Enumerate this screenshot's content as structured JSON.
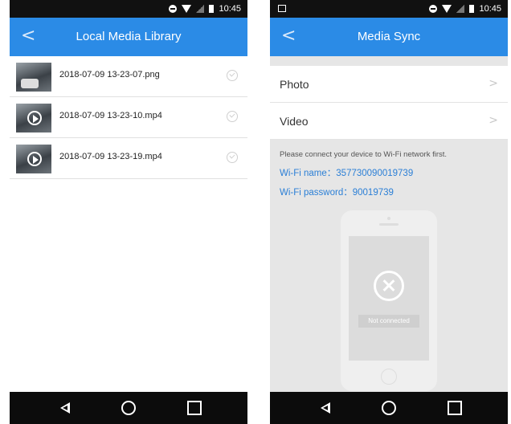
{
  "left_screen": {
    "status": {
      "time": "10:45"
    },
    "appbar": {
      "back_glyph": "<",
      "title": "Local Media Library"
    },
    "files": [
      {
        "name": "2018-07-09 13-23-07.png",
        "type": "image"
      },
      {
        "name": "2018-07-09 13-23-10.mp4",
        "type": "video"
      },
      {
        "name": "2018-07-09 13-23-19.mp4",
        "type": "video"
      }
    ]
  },
  "right_screen": {
    "status": {
      "time": "10:45"
    },
    "appbar": {
      "back_glyph": "<",
      "title": "Media Sync"
    },
    "menu": [
      {
        "label": "Photo",
        "chevron": ">"
      },
      {
        "label": "Video",
        "chevron": ">"
      }
    ],
    "note": "Please connect your device to Wi-Fi network first.",
    "wifi_name_line": "Wi-Fi name：357730090019739",
    "wifi_password_line": "Wi-Fi password：90019739",
    "phone_status": "Not connected"
  },
  "icons": {
    "status": [
      "dnd-icon",
      "wifi-icon",
      "signal-icon",
      "battery-icon"
    ],
    "nav": [
      "back-nav-icon",
      "home-nav-icon",
      "recents-nav-icon"
    ]
  },
  "colors": {
    "accent": "#2b8be6",
    "link": "#2b7fd6"
  }
}
